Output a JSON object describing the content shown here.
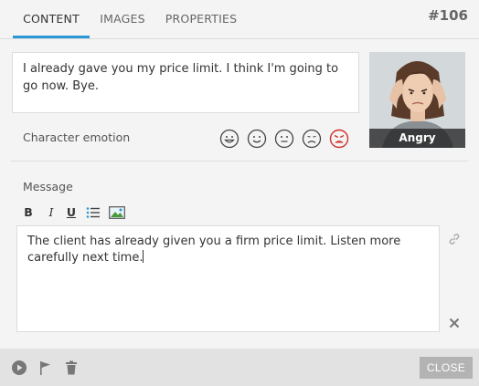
{
  "tabs": [
    {
      "label": "CONTENT",
      "active": true
    },
    {
      "label": "IMAGES",
      "active": false
    },
    {
      "label": "PROPERTIES",
      "active": false
    }
  ],
  "card_number": "#106",
  "line_text": "I already gave you my price limit. I think I'm going to go now. Bye.",
  "portrait": {
    "label": "Angry"
  },
  "character_emotion_label": "Character emotion",
  "emotions": [
    {
      "name": "very-happy",
      "selected": false
    },
    {
      "name": "happy",
      "selected": false
    },
    {
      "name": "neutral",
      "selected": false
    },
    {
      "name": "sad",
      "selected": false
    },
    {
      "name": "angry",
      "selected": true
    }
  ],
  "message": {
    "label": "Message",
    "text": "The client has already given you a firm price limit. Listen more carefully next time."
  },
  "toolbar": {
    "bold": "B",
    "italic": "I",
    "underline": "U"
  },
  "footer": {
    "close_label": "CLOSE"
  },
  "colors": {
    "accent": "#2b97d6",
    "angry": "#d0312d",
    "footer_bg": "#e2e2e2"
  }
}
